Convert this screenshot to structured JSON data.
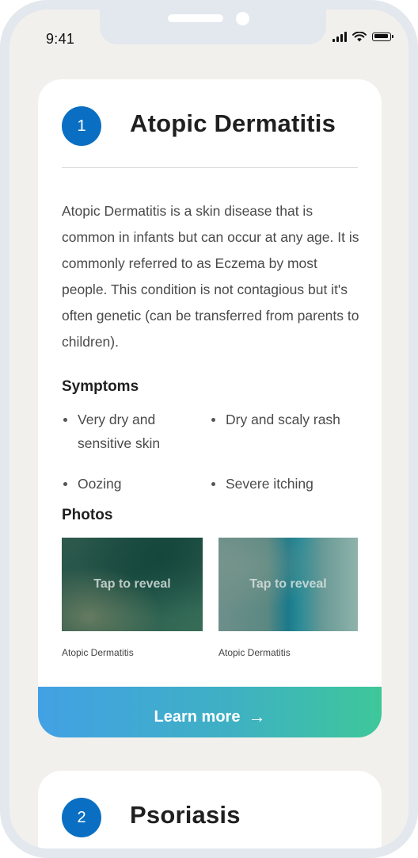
{
  "status_bar": {
    "time": "9:41",
    "icons": [
      "signal-icon",
      "wifi-icon",
      "battery-icon"
    ]
  },
  "conditions": [
    {
      "number": "1",
      "title": "Atopic Dermatitis",
      "description": "Atopic Dermatitis is a skin disease that is common in infants but can occur at any age. It is commonly referred to as Eczema by most people. This condition is not contagious but it's often genetic (can be transferred from parents to children).",
      "symptoms_heading": "Symptoms",
      "symptoms": [
        "Very dry and sensitive skin",
        "Dry and scaly rash",
        "Oozing",
        "Severe itching"
      ],
      "photos_heading": "Photos",
      "photos": [
        {
          "overlay": "Tap to reveal",
          "caption": "Atopic Dermatitis"
        },
        {
          "overlay": "Tap to reveal",
          "caption": "Atopic Dermatitis"
        }
      ],
      "learn_more_label": "Learn more",
      "learn_more_icon": "arrow-right-icon"
    },
    {
      "number": "2",
      "title": "Psoriasis"
    }
  ],
  "colors": {
    "badge": "#0a6fc2",
    "gradient_start": "#42a1e4",
    "gradient_end": "#3ec79a",
    "background": "#f2f0ec"
  }
}
